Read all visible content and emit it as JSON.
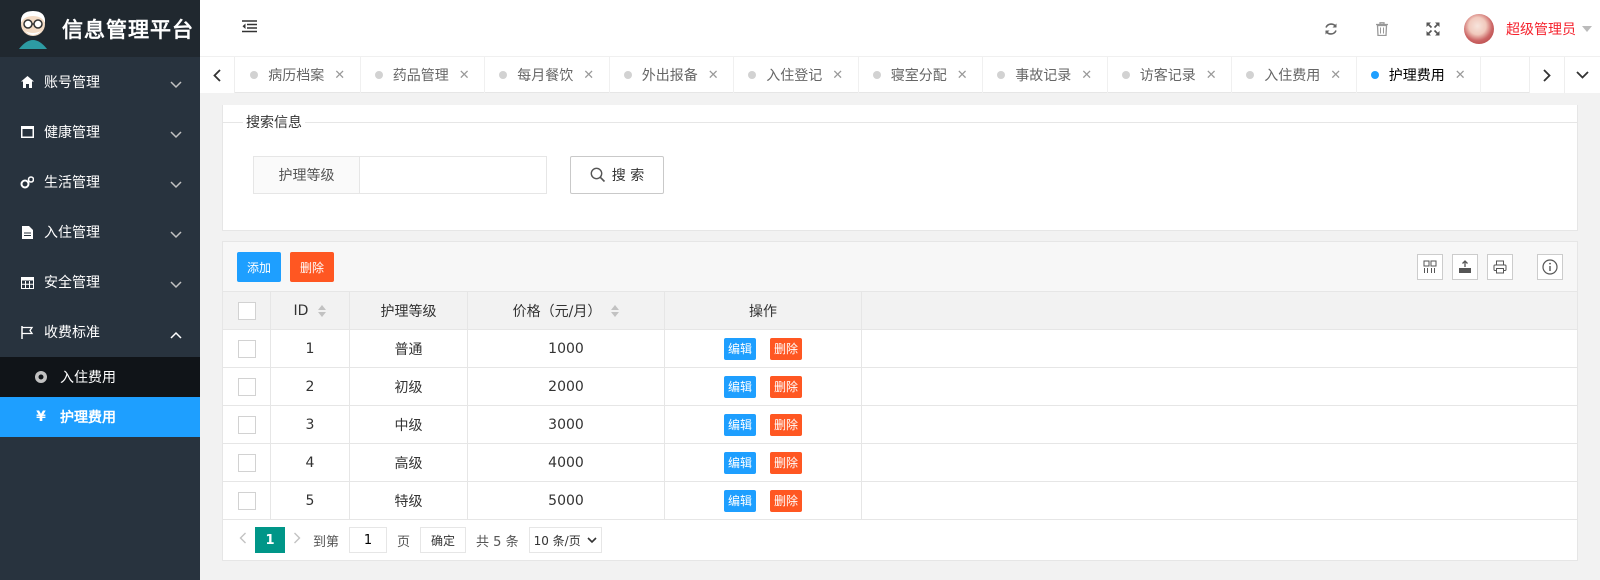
{
  "app": {
    "title": "信息管理平台"
  },
  "sidebar": {
    "items": [
      {
        "label": "账号管理",
        "icon": "home-icon"
      },
      {
        "label": "健康管理",
        "icon": "window-icon"
      },
      {
        "label": "生活管理",
        "icon": "gears-icon"
      },
      {
        "label": "入住管理",
        "icon": "file-icon"
      },
      {
        "label": "安全管理",
        "icon": "calendar-icon"
      },
      {
        "label": "收费标准",
        "icon": "flag-icon"
      }
    ],
    "sub": [
      {
        "label": "入住费用",
        "icon": "dot-circle-icon"
      },
      {
        "label": "护理费用",
        "icon": "yen-icon",
        "active": true
      }
    ]
  },
  "header": {
    "user": "超级管理员"
  },
  "tabs": [
    "病历档案",
    "药品管理",
    "每月餐饮",
    "外出报备",
    "入住登记",
    "寝室分配",
    "事故记录",
    "访客记录",
    "入住费用",
    "护理费用"
  ],
  "search": {
    "legend": "搜索信息",
    "label": "护理等级",
    "value": "",
    "button": "搜 索"
  },
  "toolbar": {
    "add": "添加",
    "delete": "删除"
  },
  "table": {
    "headers": {
      "id": "ID",
      "level": "护理等级",
      "price": "价格（元/月）",
      "ops": "操作"
    },
    "rows": [
      {
        "id": "1",
        "level": "普通",
        "price": "1000"
      },
      {
        "id": "2",
        "level": "初级",
        "price": "2000"
      },
      {
        "id": "3",
        "level": "中级",
        "price": "3000"
      },
      {
        "id": "4",
        "level": "高级",
        "price": "4000"
      },
      {
        "id": "5",
        "level": "特级",
        "price": "5000"
      }
    ],
    "edit": "编辑",
    "remove": "删除"
  },
  "pager": {
    "current": "1",
    "goto": "到第",
    "page_value": "1",
    "page_unit": "页",
    "confirm": "确定",
    "total": "共 5 条",
    "size": "10 条/页"
  },
  "colors": {
    "primary": "#1e9fff",
    "danger": "#ff5722",
    "teal": "#009688",
    "sidebar": "#28333e"
  }
}
